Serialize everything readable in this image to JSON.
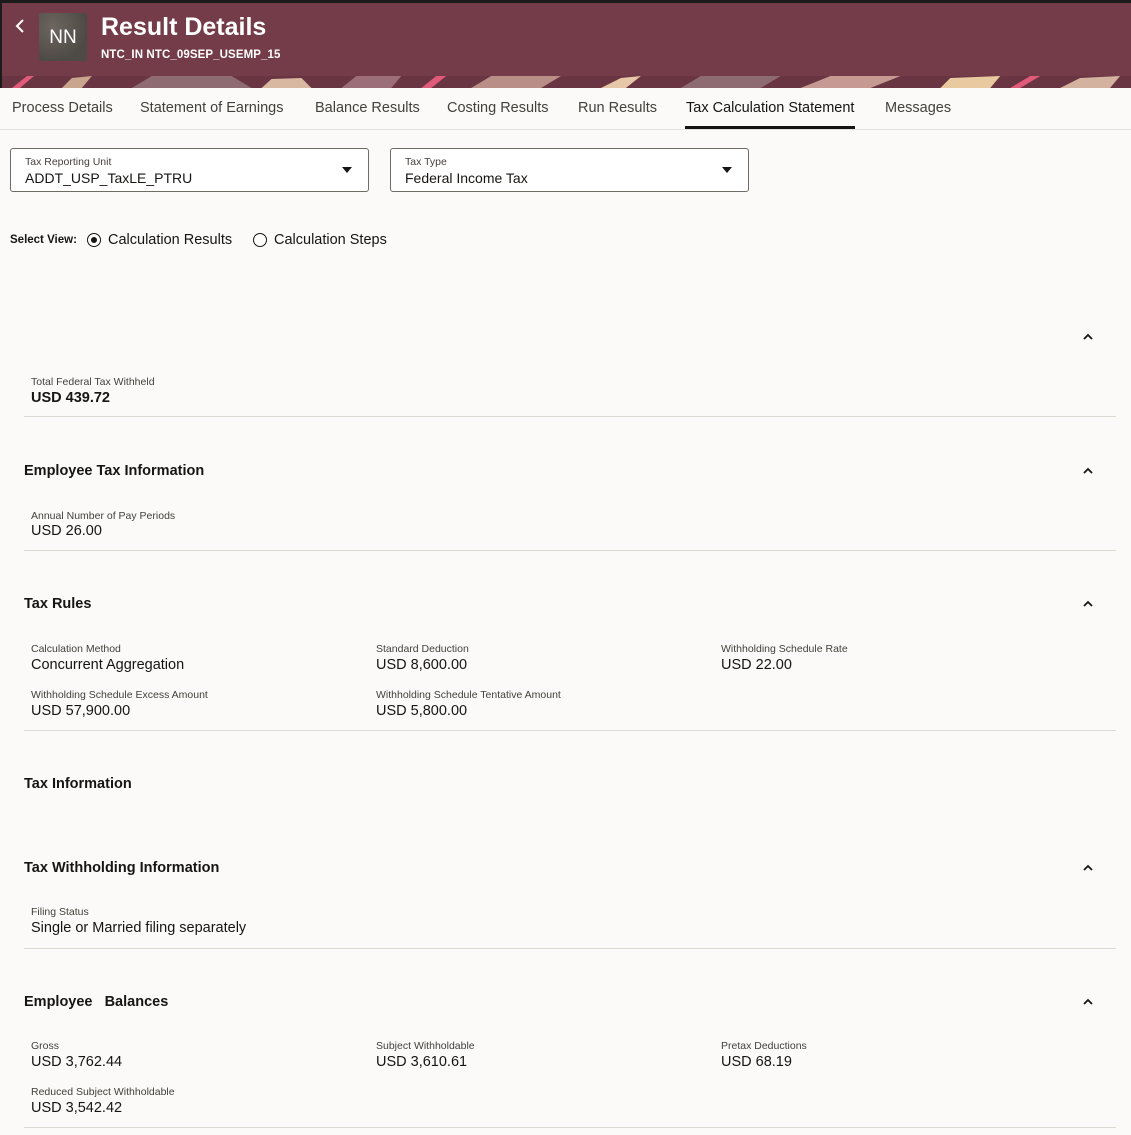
{
  "header": {
    "avatar_initials": "NN",
    "title": "Result Details",
    "subtitle": "NTC_IN NTC_09SEP_USEMP_15",
    "color": "#733c48"
  },
  "tabs": [
    {
      "label": "Process Details"
    },
    {
      "label": "Statement of Earnings"
    },
    {
      "label": "Balance Results"
    },
    {
      "label": "Costing Results"
    },
    {
      "label": "Run Results"
    },
    {
      "label": "Tax Calculation Statement",
      "active": true
    },
    {
      "label": "Messages"
    }
  ],
  "filters": {
    "tax_reporting_unit": {
      "label": "Tax Reporting Unit",
      "value": "ADDT_USP_TaxLE_PTRU"
    },
    "tax_type": {
      "label": "Tax Type",
      "value": "Federal Income Tax"
    }
  },
  "select_view": {
    "label": "Select View:",
    "options": [
      {
        "label": "Calculation Results",
        "selected": true
      },
      {
        "label": "Calculation Steps",
        "selected": false
      }
    ]
  },
  "summary": {
    "total_label": "Total Federal Tax Withheld",
    "total_value": "USD 439.72"
  },
  "employee_tax_info": {
    "title": "Employee Tax Information",
    "fields": [
      {
        "label": "Annual Number of Pay Periods",
        "value": "USD 26.00"
      }
    ]
  },
  "tax_rules": {
    "title": "Tax Rules",
    "fields": [
      {
        "label": "Calculation Method",
        "value": "Concurrent Aggregation"
      },
      {
        "label": "Standard Deduction",
        "value": "USD 8,600.00"
      },
      {
        "label": "Withholding Schedule Rate",
        "value": "USD 22.00"
      },
      {
        "label": "Withholding Schedule Excess Amount",
        "value": "USD 57,900.00"
      },
      {
        "label": "Withholding Schedule Tentative Amount",
        "value": "USD 5,800.00"
      }
    ]
  },
  "tax_information": {
    "title": "Tax Information"
  },
  "tax_withholding": {
    "title": "Tax Withholding Information",
    "fields": [
      {
        "label": "Filing Status",
        "value": "Single or Married filing separately"
      }
    ]
  },
  "employee_balances": {
    "title": "Employee   Balances",
    "fields": [
      {
        "label": "Gross",
        "value": "USD 3,762.44"
      },
      {
        "label": "Subject Withholdable",
        "value": "USD 3,610.61"
      },
      {
        "label": "Pretax Deductions",
        "value": "USD 68.19"
      },
      {
        "label": "Reduced Subject Withholdable",
        "value": "USD 3,542.42"
      }
    ]
  },
  "icons": {
    "back": "chevron-left-icon",
    "collapse": "chevron-up-icon",
    "dropdown": "caret-down-icon"
  }
}
